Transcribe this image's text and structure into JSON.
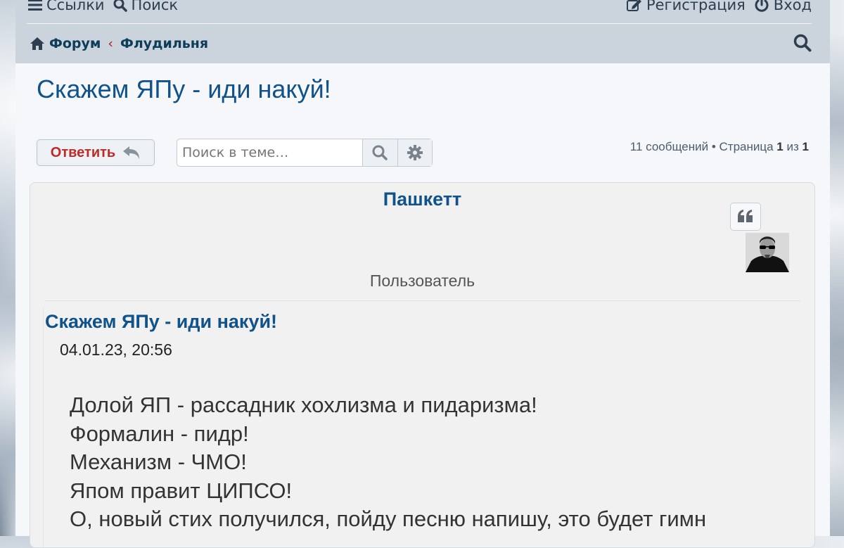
{
  "nav": {
    "links_label": "Ссылки",
    "search_label": "Поиск",
    "register_label": "Регистрация",
    "login_label": "Вход"
  },
  "breadcrumbs": {
    "forum": "Форум",
    "separator": "‹",
    "section": "Флудильня"
  },
  "topic": {
    "title": "Скажем ЯПу - иди накуй!"
  },
  "actions": {
    "reply_label": "Ответить",
    "search_placeholder": "Поиск в теме…"
  },
  "pagination": {
    "prefix": "11 сообщений • Страница",
    "current": "1",
    "of": "из",
    "total": "1"
  },
  "post": {
    "author": "Пашкетт",
    "rank": "Пользователь",
    "title": "Скажем ЯПу - иди накуй!",
    "time": "04.01.23, 20:56",
    "lines": [
      "Долой ЯП - рассадник хохлизма и пидаризма!",
      "Формалин - пидр!",
      "Механизм - ЧМО!",
      "Япом правит ЦИПСО!",
      "О, новый стих получился, пойду песню напишу, это будет гимн"
    ]
  },
  "colors": {
    "link": "#105289",
    "reply": "#bc2a2a",
    "topbar": "#cbd3dc"
  },
  "icons": [
    "bars-icon",
    "search-icon",
    "edit-icon",
    "power-icon",
    "home-icon",
    "reply-icon",
    "cog-icon",
    "quote-icon"
  ]
}
